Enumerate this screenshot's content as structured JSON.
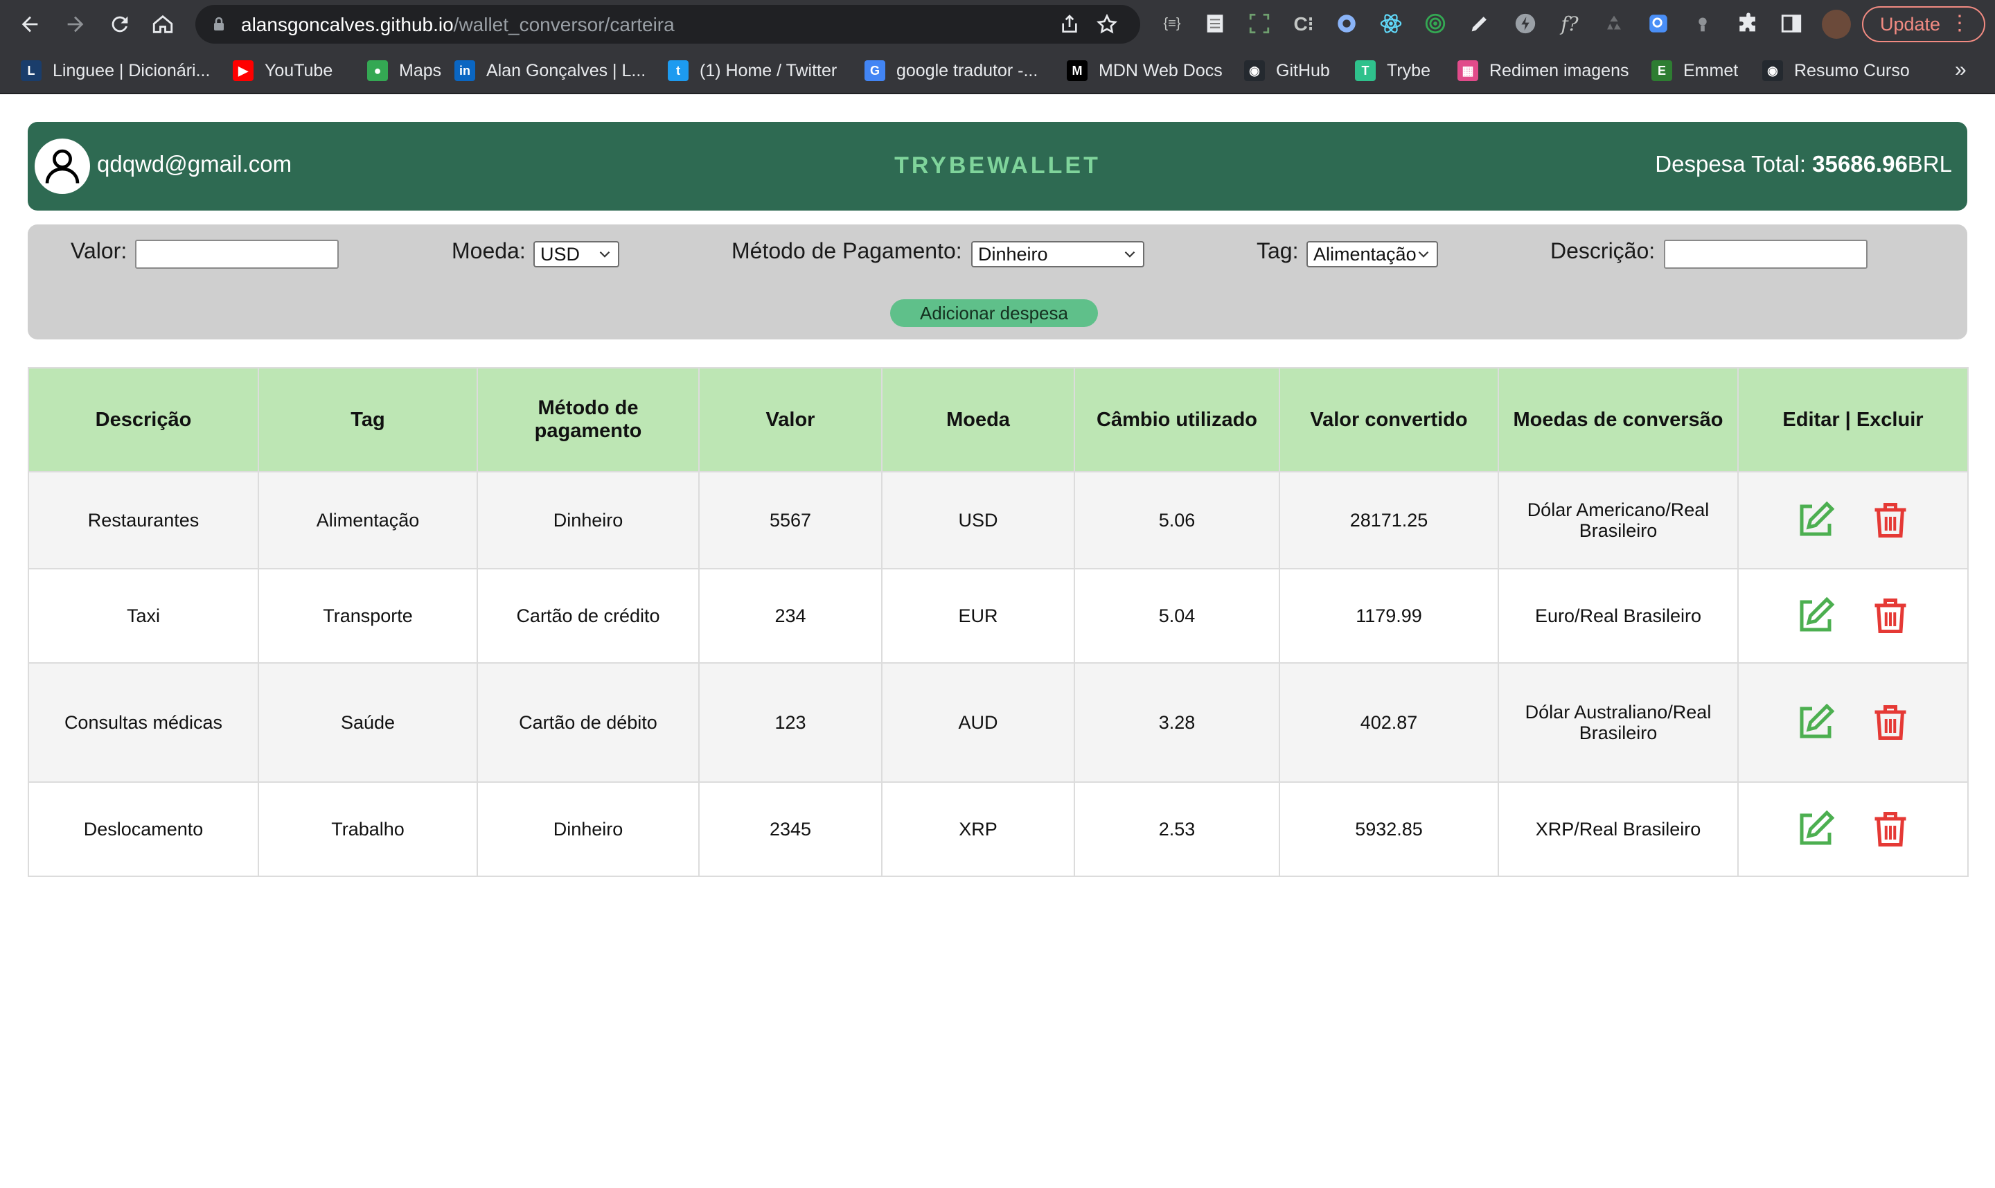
{
  "browser": {
    "url_host": "alansgoncalves.github.io",
    "url_path": "/wallet_conversor/carteira",
    "update_label": "Update",
    "bookmarks": [
      {
        "label": "Linguee | Dicionári...",
        "icon": "linguee-icon",
        "color": "#1a3d6b",
        "glyph": "L"
      },
      {
        "label": "YouTube",
        "icon": "youtube-icon",
        "color": "#ff0000",
        "glyph": "▶"
      },
      {
        "label": "Maps",
        "icon": "maps-icon",
        "color": "#34a853",
        "glyph": "●"
      },
      {
        "label": "Alan Gonçalves | L...",
        "icon": "linkedin-icon",
        "color": "#0a66c2",
        "glyph": "in"
      },
      {
        "label": "(1) Home / Twitter",
        "icon": "twitter-icon",
        "color": "#1d9bf0",
        "glyph": "t"
      },
      {
        "label": "google tradutor -...",
        "icon": "google-icon",
        "color": "#4285f4",
        "glyph": "G"
      },
      {
        "label": "MDN Web Docs",
        "icon": "mdn-icon",
        "color": "#000000",
        "glyph": "M"
      },
      {
        "label": "GitHub",
        "icon": "github-icon",
        "color": "#24292f",
        "glyph": "◉"
      },
      {
        "label": "Trybe",
        "icon": "trybe-icon",
        "color": "#2fc18c",
        "glyph": "T"
      },
      {
        "label": "Redimen imagens",
        "icon": "redimen-icon",
        "color": "#e14b8a",
        "glyph": "▦"
      },
      {
        "label": "Emmet",
        "icon": "emmet-icon",
        "color": "#2e7d32",
        "glyph": "E"
      },
      {
        "label": "Resumo Curso",
        "icon": "github-icon",
        "color": "#24292f",
        "glyph": "◉"
      }
    ],
    "more_label": "»"
  },
  "header": {
    "email": "qdqwd@gmail.com",
    "brand": "TRYBEWALLET",
    "total_label": "Despesa Total: ",
    "total_value": "35686.96",
    "currency": "BRL"
  },
  "form": {
    "valor_label": "Valor:",
    "moeda_label": "Moeda:",
    "moeda_value": "USD",
    "metodo_label": "Método de Pagamento:",
    "metodo_value": "Dinheiro",
    "tag_label": "Tag:",
    "tag_value": "Alimentação",
    "descricao_label": "Descrição:",
    "add_button": "Adicionar despesa"
  },
  "table": {
    "headers": [
      "Descrição",
      "Tag",
      "Método de pagamento",
      "Valor",
      "Moeda",
      "Câmbio utilizado",
      "Valor convertido",
      "Moedas de conversão",
      "Editar | Excluir"
    ],
    "rows": [
      [
        "Restaurantes",
        "Alimentação",
        "Dinheiro",
        "5567",
        "USD",
        "5.06",
        "28171.25",
        "Dólar Americano/Real Brasileiro"
      ],
      [
        "Taxi",
        "Transporte",
        "Cartão de crédito",
        "234",
        "EUR",
        "5.04",
        "1179.99",
        "Euro/Real Brasileiro"
      ],
      [
        "Consultas médicas",
        "Saúde",
        "Cartão de débito",
        "123",
        "AUD",
        "3.28",
        "402.87",
        "Dólar Australiano/Real Brasileiro"
      ],
      [
        "Deslocamento",
        "Trabalho",
        "Dinheiro",
        "2345",
        "XRP",
        "2.53",
        "5932.85",
        "XRP/Real Brasileiro"
      ]
    ]
  },
  "colors": {
    "header_bg": "#2e6a52",
    "brand_text": "#7fd49b",
    "table_header_bg": "#bde6b4",
    "edit_icon": "#4caf50",
    "delete_icon": "#e53935",
    "add_button_bg": "#5fc08a"
  }
}
